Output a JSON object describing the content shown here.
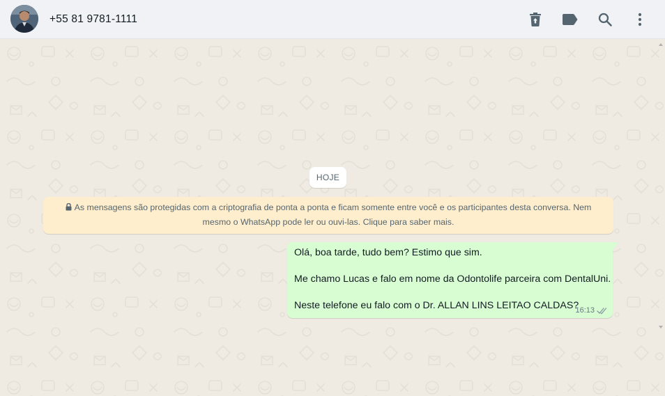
{
  "header": {
    "contact_name": "+55 81 9781-1111",
    "icons": [
      "delete-icon",
      "label-icon",
      "search-icon",
      "menu-icon"
    ]
  },
  "chat": {
    "date_chip": "HOJE",
    "e2e_notice": {
      "line1": "As mensagens são protegidas com a criptografia de ponta a ponta e ficam somente entre você e os participantes desta conversa. Nem",
      "line2": "mesmo o WhatsApp pode ler ou ouvi-las. Clique para saber mais."
    },
    "messages": [
      {
        "direction": "outgoing",
        "lines": [
          "Olá, boa tarde, tudo bem? Estimo que sim.",
          "Me chamo Lucas e falo em nome da Odontolife parceira com DentalUni.",
          "Neste telefone eu falo com o Dr. ALLAN LINS LEITAO CALDAS?"
        ],
        "time": "16:13",
        "status": "read"
      }
    ]
  },
  "colors": {
    "header_bg": "#f0f2f5",
    "chat_bg": "#efeae2",
    "outgoing_bubble": "#d9fdd3",
    "notice_bg": "#ffeecd",
    "icon_color": "#54656f",
    "read_tick": "#8696a0"
  }
}
